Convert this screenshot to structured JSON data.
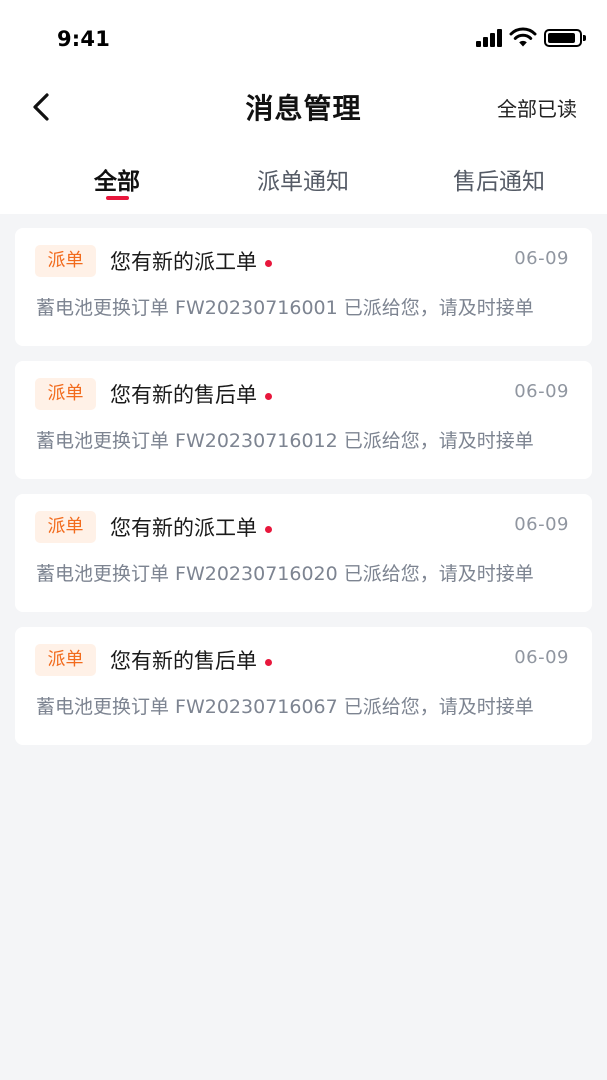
{
  "status_bar": {
    "time": "9:41",
    "icons": [
      "signal-icon",
      "wifi-icon",
      "battery-icon"
    ]
  },
  "header": {
    "title": "消息管理",
    "mark_all_read": "全部已读",
    "back_icon": "chevron-left-icon"
  },
  "tabs": [
    {
      "label": "全部",
      "active": true
    },
    {
      "label": "派单通知",
      "active": false
    },
    {
      "label": "售后通知",
      "active": false
    }
  ],
  "messages": [
    {
      "tag": "派单",
      "title": "您有新的派工单",
      "unread": true,
      "date": "06-09",
      "content": "蓄电池更换订单 FW20230716001 已派给您，请及时接单"
    },
    {
      "tag": "派单",
      "title": "您有新的售后单",
      "unread": true,
      "date": "06-09",
      "content": "蓄电池更换订单 FW20230716012 已派给您，请及时接单"
    },
    {
      "tag": "派单",
      "title": "您有新的派工单",
      "unread": true,
      "date": "06-09",
      "content": "蓄电池更换订单 FW20230716020 已派给您，请及时接单"
    },
    {
      "tag": "派单",
      "title": "您有新的售后单",
      "unread": true,
      "date": "06-09",
      "content": "蓄电池更换订单 FW20230716067 已派给您，请及时接单"
    }
  ],
  "colors": {
    "accent": "#e8173c",
    "tag_bg": "#fff1e7",
    "tag_text": "#f26b1d",
    "page_bg": "#f4f5f7"
  }
}
